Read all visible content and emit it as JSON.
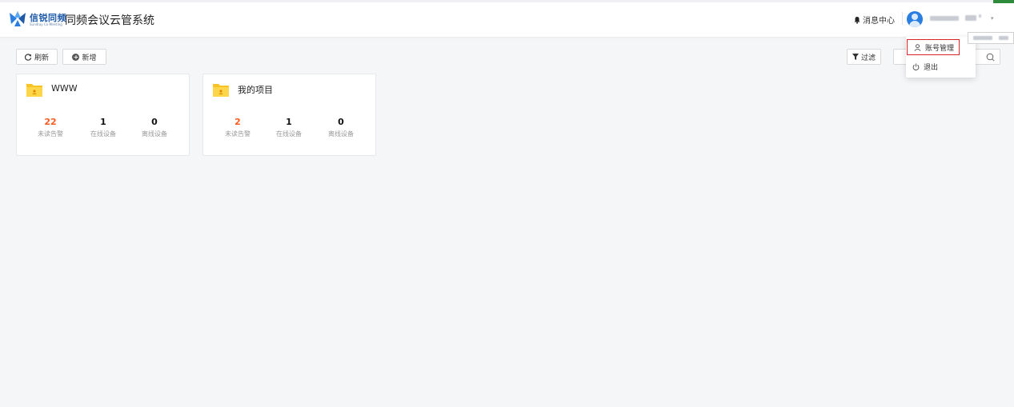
{
  "header": {
    "logo_text": "信锐同频",
    "logo_subtext": "Sundray Co-Meeting",
    "app_title": "同频会议云管系统",
    "message_center": "消息中心",
    "bell_icon": "bell-icon",
    "avatar_icon": "user-avatar-icon",
    "caret_icon": "caret-down-icon"
  },
  "toolbar": {
    "refresh_label": "刷新",
    "add_label": "新增",
    "filter_label": "过滤",
    "refresh_icon": "refresh-icon",
    "add_icon": "plus-circle-icon",
    "filter_icon": "filter-icon",
    "search_icon": "search-icon"
  },
  "projects": [
    {
      "name": "WWW",
      "stats": [
        {
          "value": "22",
          "label": "未读告警"
        },
        {
          "value": "1",
          "label": "在线设备"
        },
        {
          "value": "0",
          "label": "离线设备"
        }
      ]
    },
    {
      "name": "我的项目",
      "stats": [
        {
          "value": "2",
          "label": "未读告警"
        },
        {
          "value": "1",
          "label": "在线设备"
        },
        {
          "value": "0",
          "label": "离线设备"
        }
      ]
    }
  ],
  "user_menu": {
    "items": [
      {
        "label": "账号管理",
        "icon": "user-icon"
      },
      {
        "label": "退出",
        "icon": "power-icon"
      }
    ]
  },
  "colors": {
    "brand": "#1e5aa8",
    "alert": "#ff5a1f",
    "folder": "#f7c325",
    "highlight_border": "#d9262c"
  }
}
